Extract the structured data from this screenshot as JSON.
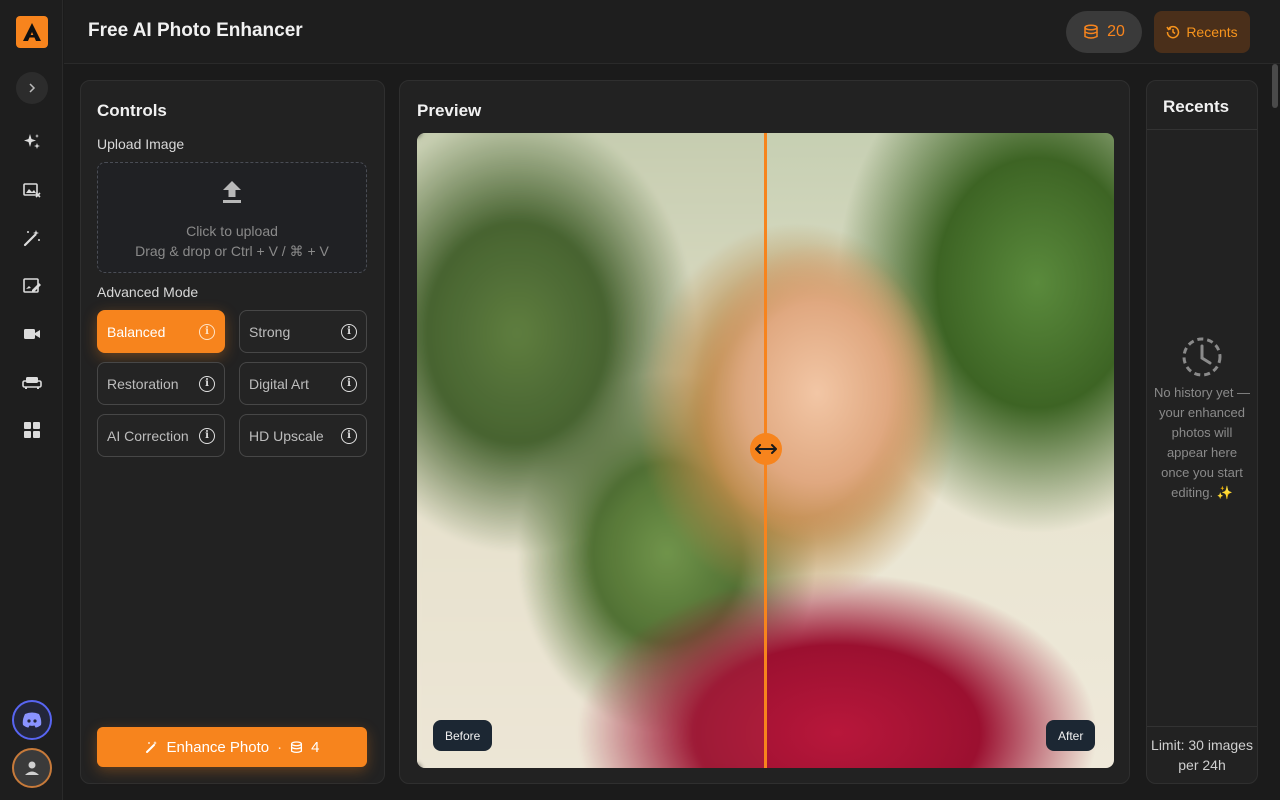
{
  "app": {
    "logo_letter": "A",
    "brand_color": "#f7841d"
  },
  "sidebar": {
    "expand_icon": "chevron-right-icon",
    "items": [
      {
        "name": "sparkles-icon"
      },
      {
        "name": "image-remove-icon"
      },
      {
        "name": "magic-wand-icon"
      },
      {
        "name": "image-edit-icon"
      },
      {
        "name": "video-camera-icon"
      },
      {
        "name": "sofa-icon"
      },
      {
        "name": "grid-apps-icon"
      }
    ]
  },
  "header": {
    "title": "Free AI Photo Enhancer",
    "credits": "20",
    "recents_label": "Recents"
  },
  "controls": {
    "title": "Controls",
    "upload_label": "Upload Image",
    "upload_line1": "Click to upload",
    "upload_line2": "Drag & drop or Ctrl + V / ⌘ + V",
    "mode_label": "Advanced Mode",
    "modes": [
      {
        "label": "Balanced",
        "active": true
      },
      {
        "label": "Strong",
        "active": false
      },
      {
        "label": "Restoration",
        "active": false
      },
      {
        "label": "Digital Art",
        "active": false
      },
      {
        "label": "AI Correction",
        "active": false
      },
      {
        "label": "HD Upscale",
        "active": false
      }
    ],
    "enhance_label": "Enhance Photo",
    "enhance_separator": "·",
    "enhance_cost": "4"
  },
  "preview": {
    "title": "Preview",
    "before_label": "Before",
    "after_label": "After",
    "slider_position": 0.5
  },
  "recents": {
    "title": "Recents",
    "empty_text": "No history yet — your enhanced photos will appear here once you start editing. ✨",
    "limit_text": "Limit: 30 images per 24h"
  }
}
